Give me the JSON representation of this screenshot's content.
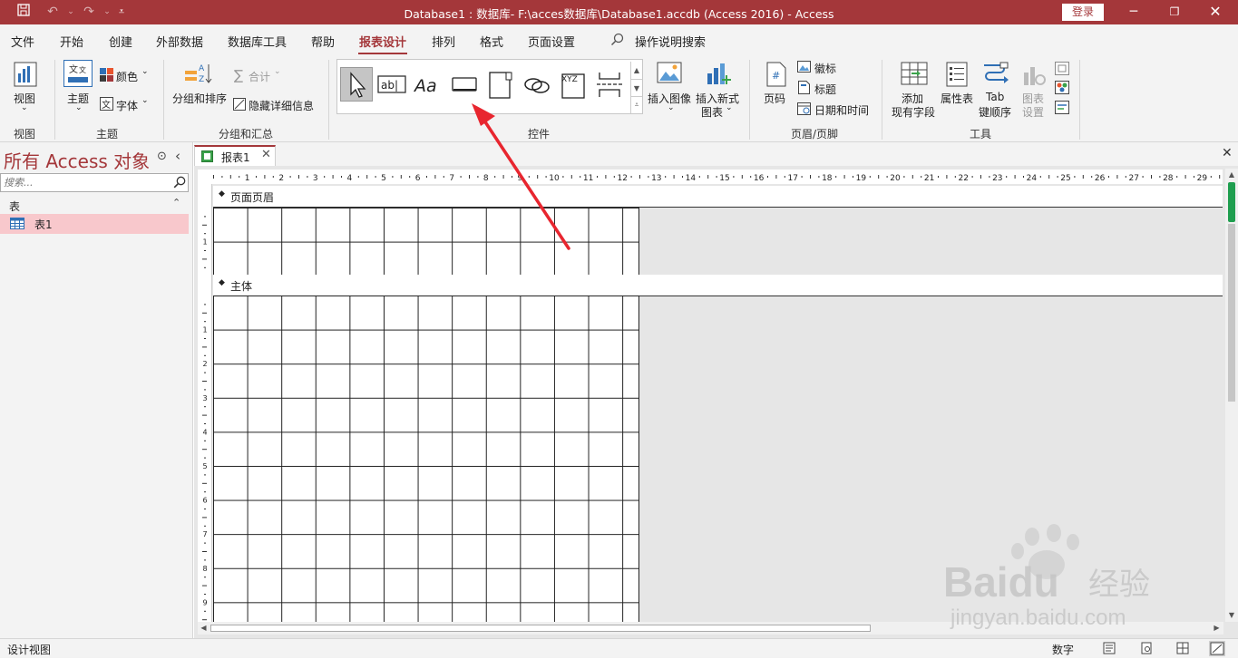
{
  "titlebar": {
    "title": "Database1 : 数据库- F:\\acces数据库\\Database1.accdb (Access 2016)  -  Access",
    "login": "登录"
  },
  "menu": {
    "tabs": [
      "文件",
      "开始",
      "创建",
      "外部数据",
      "数据库工具",
      "帮助",
      "报表设计",
      "排列",
      "格式",
      "页面设置"
    ],
    "active_index": 6,
    "tell_me": "操作说明搜索"
  },
  "ribbon": {
    "groups": {
      "view": "视图",
      "themes": "主题",
      "grouping": "分组和汇总",
      "controls": "控件",
      "header_footer": "页眉/页脚",
      "tools": "工具"
    },
    "view_btn": "视图",
    "themes_btn": "主题",
    "colors_btn": "颜色",
    "fonts_btn": "字体",
    "group_sort": "分组和排序",
    "totals": "合计",
    "hide_details": "隐藏详细信息",
    "insert_image": "插入图像",
    "insert_chart_1": "插入新式",
    "insert_chart_2": "图表",
    "page_number": "页码",
    "logo": "徽标",
    "title": "标题",
    "datetime": "日期和时间",
    "add_fields_1": "添加",
    "add_fields_2": "现有字段",
    "property_sheet": "属性表",
    "tab_order_1": "Tab",
    "tab_order_2": "键顺序",
    "chart_settings_1": "图表",
    "chart_settings_2": "设置",
    "ctl_textbox": "ab|",
    "ctl_label": "Aa",
    "ctl_combo": "XYZ"
  },
  "nav": {
    "title": "所有 Access 对象",
    "search_placeholder": "搜索...",
    "category": "表",
    "item": "表1"
  },
  "document": {
    "tab": "报表1",
    "sections": [
      "页面页眉",
      "主体"
    ],
    "ruler": [
      "1",
      "2",
      "3",
      "4",
      "5",
      "6",
      "7",
      "8",
      "9",
      "10",
      "11",
      "12",
      "13",
      "14",
      "15",
      "16",
      "17",
      "18",
      "19",
      "20",
      "21",
      "22",
      "23",
      "24",
      "25",
      "26",
      "27",
      "28",
      "29"
    ],
    "vruler_header": [
      "1"
    ],
    "vruler_body": [
      "1",
      "2",
      "3",
      "4",
      "5",
      "6",
      "7",
      "8",
      "9"
    ]
  },
  "status": {
    "left": "设计视图",
    "mode": "数字"
  },
  "watermark": {
    "brand": "Baidu",
    "brand_cn": "经验",
    "url": "jingyan.baidu.com"
  },
  "colors": {
    "accent": "#a4373a",
    "ribbon_bg": "#f3f3f3",
    "nav_selected": "#f8c8cc",
    "arrow": "#e8262f"
  }
}
